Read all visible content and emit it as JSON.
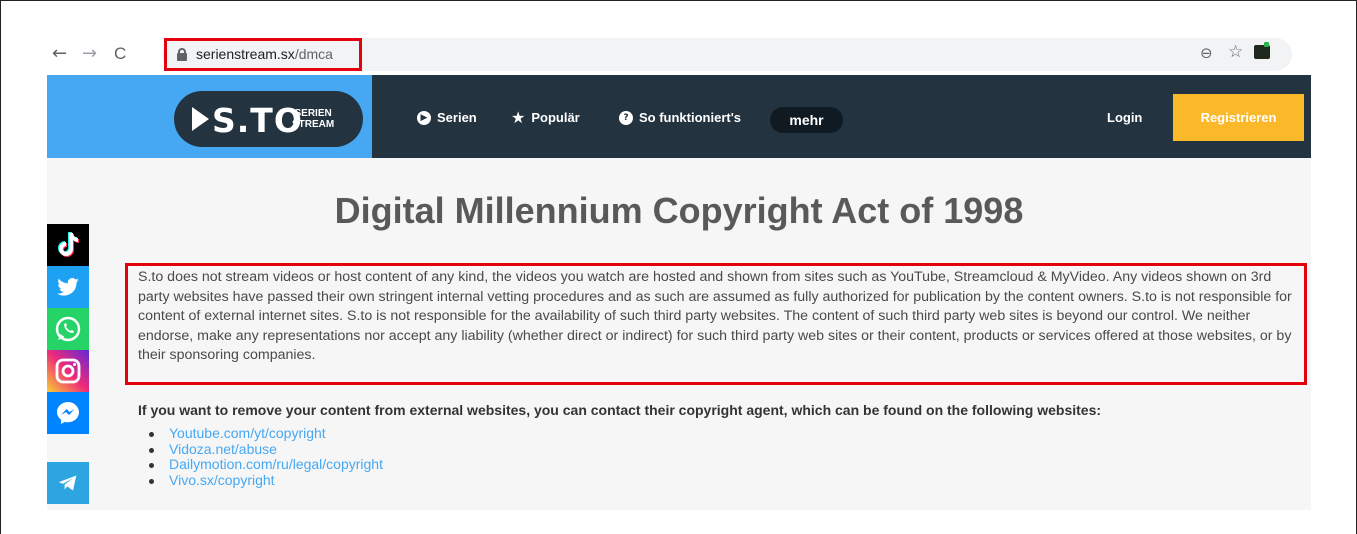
{
  "browser": {
    "url_domain": "serienstream.sx",
    "url_path": "/dmca",
    "back_icon": "←",
    "forward_icon": "→",
    "reload_icon": "C",
    "zoom_icon": "⊖",
    "star_icon": "☆"
  },
  "header": {
    "logo_text": "S.TO",
    "logo_sub_line1": "SERIEN",
    "logo_sub_line2": "STREAM",
    "nav": [
      {
        "label": "Serien",
        "icon": "play-circle-icon"
      },
      {
        "label": "Populär",
        "icon": "star-icon"
      },
      {
        "label": "So funktioniert's",
        "icon": "question-circle-icon"
      }
    ],
    "more_label": "mehr",
    "login_label": "Login",
    "register_label": "Registrieren"
  },
  "main": {
    "title": "Digital Millennium Copyright Act of 1998",
    "notice": "S.to does not stream videos or host content of any kind, the videos you watch are hosted and shown from sites such as YouTube, Streamcloud & MyVideo. Any videos shown on 3rd party websites have passed their own stringent internal vetting procedures and as such are assumed as fully authorized for publication by the content owners. S.to is not responsible for content of external internet sites. S.to is not responsible for the availability of such third party websites. The content of such third party web sites is beyond our control. We neither endorse, make any representations nor accept any liability (whether direct or indirect) for such third party web sites or their content, products or services offered at those websites, or by their sponsoring companies.",
    "remove_heading": "If you want to remove your content from external websites, you can contact their copyright agent, which can be found on the following websites:",
    "links": [
      "Youtube.com/yt/copyright",
      "Vidoza.net/abuse",
      "Dailymotion.com/ru/legal/copyright",
      "Vivo.sx/copyright"
    ]
  },
  "social": [
    {
      "name": "tiktok",
      "color": "#000000"
    },
    {
      "name": "twitter",
      "color": "#1da1f2"
    },
    {
      "name": "whatsapp",
      "color": "#25d366"
    },
    {
      "name": "instagram",
      "color": "#c13584"
    },
    {
      "name": "messenger",
      "color": "#0084ff"
    },
    {
      "name": "telegram",
      "color": "#2ca5e0"
    }
  ],
  "colors": {
    "accent_blue": "#46a8f3",
    "header_dark": "#243340",
    "register_orange": "#fbb829",
    "highlight_red": "#e3000f"
  }
}
